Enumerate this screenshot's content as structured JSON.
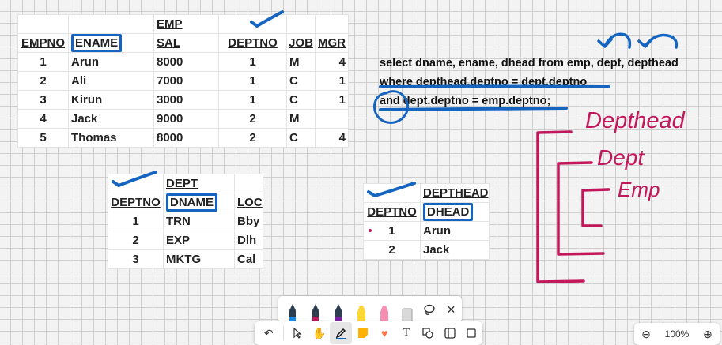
{
  "emp_table": {
    "title": "EMP",
    "headers": [
      "EMPNO",
      "ENAME",
      "SAL",
      "DEPTNO",
      "JOB",
      "MGR"
    ],
    "rows": [
      [
        "1",
        "Arun",
        "8000",
        "1",
        "M",
        "4"
      ],
      [
        "2",
        "Ali",
        "7000",
        "1",
        "C",
        "1"
      ],
      [
        "3",
        "Kirun",
        "3000",
        "1",
        "C",
        "1"
      ],
      [
        "4",
        "Jack",
        "9000",
        "2",
        "M",
        ""
      ],
      [
        "5",
        "Thomas",
        "8000",
        "2",
        "C",
        "4"
      ]
    ]
  },
  "dept_table": {
    "title": "DEPT",
    "headers": [
      "DEPTNO",
      "DNAME",
      "LOC"
    ],
    "rows": [
      [
        "1",
        "TRN",
        "Bby"
      ],
      [
        "2",
        "EXP",
        "Dlh"
      ],
      [
        "3",
        "MKTG",
        "Cal"
      ]
    ]
  },
  "depthead_table": {
    "title": "DEPTHEAD",
    "headers": [
      "DEPTNO",
      "DHEAD"
    ],
    "rows": [
      [
        "1",
        "Arun"
      ],
      [
        "2",
        "Jack"
      ]
    ]
  },
  "sql_query": {
    "line1": "select dname, ename, dhead from emp, dept, depthead",
    "line2": "where depthead.deptno = dept.deptno",
    "line3": "and dept.deptno = emp.deptno;"
  },
  "handwriting": {
    "depthead": "Depthead",
    "dept": "Dept",
    "emp": "Emp"
  },
  "colors": {
    "ink_blue": "#1565c0",
    "ink_magenta": "#c2185b"
  },
  "toolbar": {
    "pens": [
      {
        "name": "blue-pen",
        "color": "#1e88e5"
      },
      {
        "name": "magenta-pen",
        "color": "#c2185b"
      },
      {
        "name": "purple-pen",
        "color": "#7b1fa2"
      },
      {
        "name": "yellow-highlighter",
        "color": "#fdd835"
      },
      {
        "name": "pink-highlighter",
        "color": "#f48fb1"
      },
      {
        "name": "eraser",
        "color": "#d9d9d9"
      }
    ]
  },
  "zoom": {
    "level": "100%",
    "minus": "⊖",
    "plus": "⊕"
  }
}
